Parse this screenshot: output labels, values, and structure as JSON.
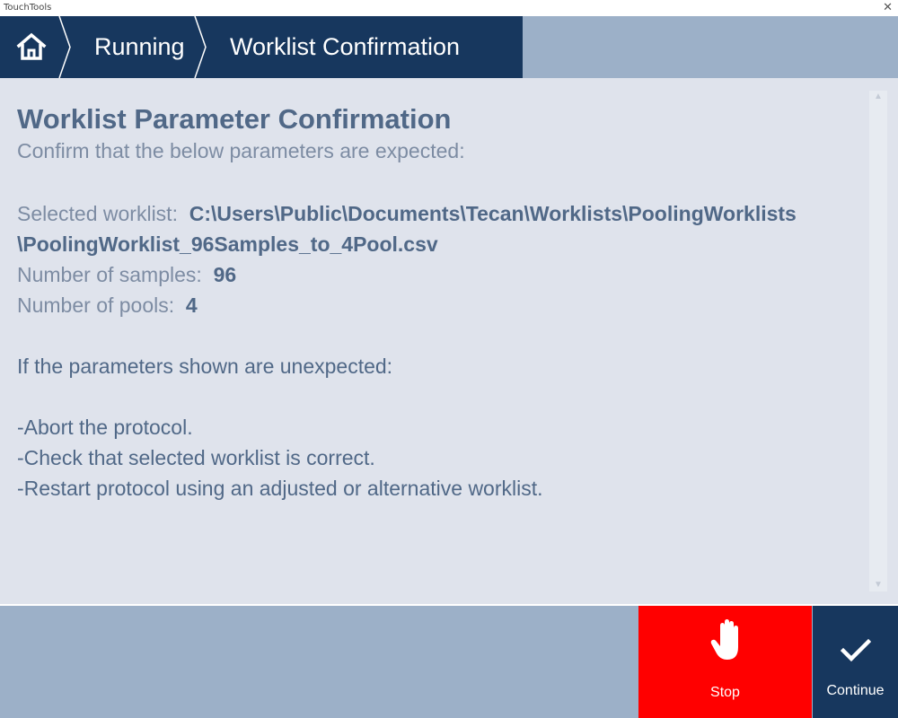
{
  "window": {
    "title": "TouchTools",
    "close_icon": "close-icon"
  },
  "breadcrumb": {
    "home_icon": "home-icon",
    "items": [
      {
        "label": "Running"
      },
      {
        "label": "Worklist Confirmation"
      }
    ]
  },
  "main": {
    "heading": "Worklist Parameter Confirmation",
    "subheading": "Confirm that the below parameters are expected:",
    "selected_worklist_label": "Selected worklist:",
    "selected_worklist_line1": "C:\\Users\\Public\\Documents\\Tecan\\Worklists\\PoolingWorklists",
    "selected_worklist_line2": "\\PoolingWorklist_96Samples_to_4Pool.csv",
    "samples_label": "Number of samples:",
    "samples_value": "96",
    "pools_label": "Number of pools:",
    "pools_value": "4",
    "unexpected_heading": "If the parameters shown are unexpected:",
    "steps": [
      "-Abort the protocol.",
      "-Check that selected worklist is correct.",
      "-Restart protocol using an adjusted or alternative worklist."
    ]
  },
  "footer": {
    "stop_label": "Stop",
    "stop_icon": "hand-stop-icon",
    "continue_label": "Continue",
    "continue_icon": "checkmark-icon"
  },
  "colors": {
    "header_dark": "#17375e",
    "header_light": "#9cb0c8",
    "content_bg": "#dfe3ec",
    "stop_red": "#ff0000",
    "text_dark": "#506887",
    "text_light": "#7d8ca3"
  }
}
